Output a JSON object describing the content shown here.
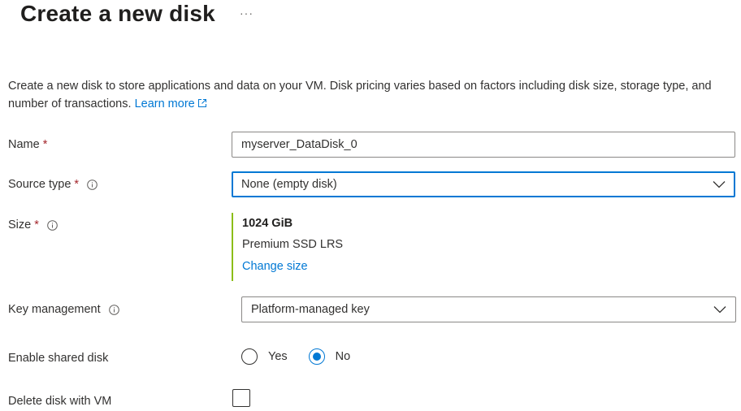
{
  "header": {
    "title": "Create a new disk",
    "more_label": "···"
  },
  "description": {
    "text": "Create a new disk to store applications and data on your VM. Disk pricing varies based on factors including disk size, storage type, and number of transactions.",
    "learn_more": "Learn more"
  },
  "form": {
    "name": {
      "label": "Name",
      "required_mark": "*",
      "value": "myserver_DataDisk_0"
    },
    "source_type": {
      "label": "Source type",
      "required_mark": "*",
      "value": "None (empty disk)"
    },
    "size": {
      "label": "Size",
      "required_mark": "*",
      "value": "1024 GiB",
      "tier": "Premium SSD LRS",
      "change_label": "Change size"
    },
    "key_management": {
      "label": "Key management",
      "value": "Platform-managed key"
    },
    "shared_disk": {
      "label": "Enable shared disk",
      "options": [
        {
          "label": "Yes",
          "checked": false
        },
        {
          "label": "No",
          "checked": true
        }
      ]
    },
    "delete_with_vm": {
      "label": "Delete disk with VM",
      "checked": false
    }
  },
  "colors": {
    "accent": "#0078d4",
    "required": "#a4262c",
    "size_bar": "#8cbd18"
  },
  "icons": {
    "info": "info-icon",
    "external": "external-link-icon",
    "chevron": "chevron-down-icon"
  }
}
